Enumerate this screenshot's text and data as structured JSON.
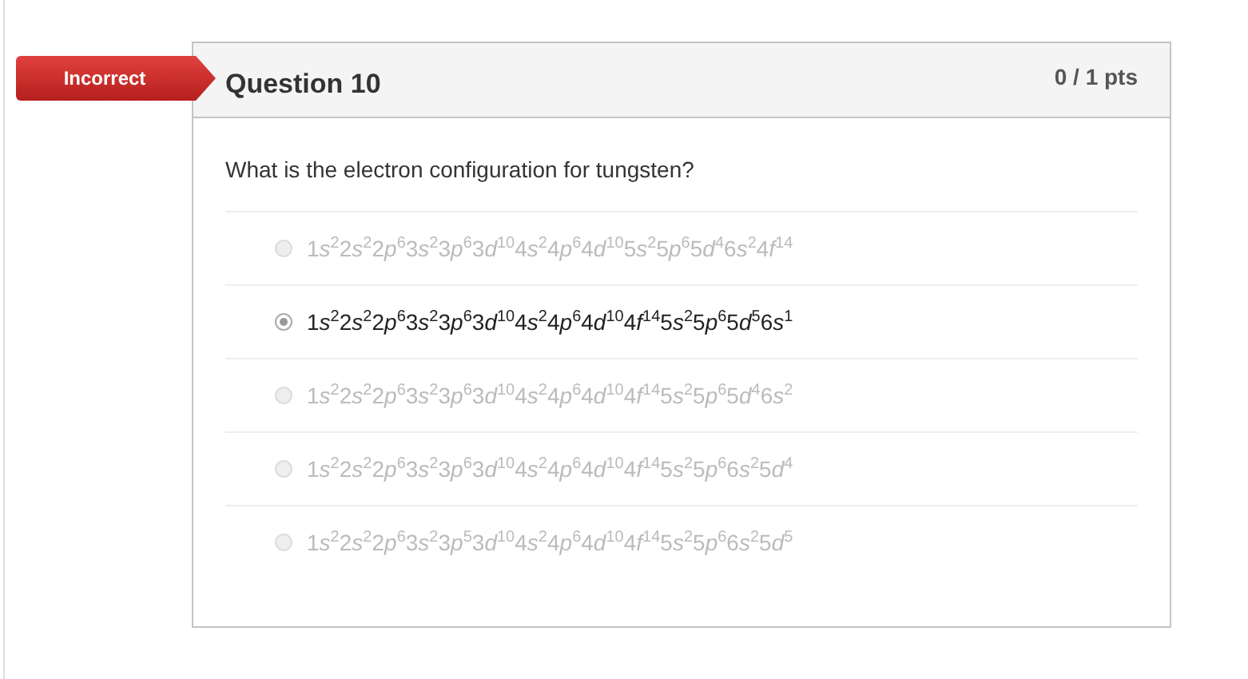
{
  "result_badge": "Incorrect",
  "question": {
    "title": "Question 10",
    "points": "0 / 1 pts",
    "text": "What is the electron configuration for tungsten?"
  },
  "answers": [
    {
      "selected": false,
      "terms": [
        [
          "1",
          "s",
          "2"
        ],
        [
          "2",
          "s",
          "2"
        ],
        [
          "2",
          "p",
          "6"
        ],
        [
          "3",
          "s",
          "2"
        ],
        [
          "3",
          "p",
          "6"
        ],
        [
          "3",
          "d",
          "10"
        ],
        [
          "4",
          "s",
          "2"
        ],
        [
          "4",
          "p",
          "6"
        ],
        [
          "4",
          "d",
          "10"
        ],
        [
          "5",
          "s",
          "2"
        ],
        [
          "5",
          "p",
          "6"
        ],
        [
          "5",
          "d",
          "4"
        ],
        [
          "6",
          "s",
          "2"
        ],
        [
          "4",
          "f",
          "14"
        ]
      ]
    },
    {
      "selected": true,
      "terms": [
        [
          "1",
          "s",
          "2"
        ],
        [
          "2",
          "s",
          "2"
        ],
        [
          "2",
          "p",
          "6"
        ],
        [
          "3",
          "s",
          "2"
        ],
        [
          "3",
          "p",
          "6"
        ],
        [
          "3",
          "d",
          "10"
        ],
        [
          "4",
          "s",
          "2"
        ],
        [
          "4",
          "p",
          "6"
        ],
        [
          "4",
          "d",
          "10"
        ],
        [
          "4",
          "f",
          "14"
        ],
        [
          "5",
          "s",
          "2"
        ],
        [
          "5",
          "p",
          "6"
        ],
        [
          "5",
          "d",
          "5"
        ],
        [
          "6",
          "s",
          "1"
        ]
      ]
    },
    {
      "selected": false,
      "terms": [
        [
          "1",
          "s",
          "2"
        ],
        [
          "2",
          "s",
          "2"
        ],
        [
          "2",
          "p",
          "6"
        ],
        [
          "3",
          "s",
          "2"
        ],
        [
          "3",
          "p",
          "6"
        ],
        [
          "3",
          "d",
          "10"
        ],
        [
          "4",
          "s",
          "2"
        ],
        [
          "4",
          "p",
          "6"
        ],
        [
          "4",
          "d",
          "10"
        ],
        [
          "4",
          "f",
          "14"
        ],
        [
          "5",
          "s",
          "2"
        ],
        [
          "5",
          "p",
          "6"
        ],
        [
          "5",
          "d",
          "4"
        ],
        [
          "6",
          "s",
          "2"
        ]
      ]
    },
    {
      "selected": false,
      "terms": [
        [
          "1",
          "s",
          "2"
        ],
        [
          "2",
          "s",
          "2"
        ],
        [
          "2",
          "p",
          "6"
        ],
        [
          "3",
          "s",
          "2"
        ],
        [
          "3",
          "p",
          "6"
        ],
        [
          "3",
          "d",
          "10"
        ],
        [
          "4",
          "s",
          "2"
        ],
        [
          "4",
          "p",
          "6"
        ],
        [
          "4",
          "d",
          "10"
        ],
        [
          "4",
          "f",
          "14"
        ],
        [
          "5",
          "s",
          "2"
        ],
        [
          "5",
          "p",
          "6"
        ],
        [
          "6",
          "s",
          "2"
        ],
        [
          "5",
          "d",
          "4"
        ]
      ]
    },
    {
      "selected": false,
      "terms": [
        [
          "1",
          "s",
          "2"
        ],
        [
          "2",
          "s",
          "2"
        ],
        [
          "2",
          "p",
          "6"
        ],
        [
          "3",
          "s",
          "2"
        ],
        [
          "3",
          "p",
          "5"
        ],
        [
          "3",
          "d",
          "10"
        ],
        [
          "4",
          "s",
          "2"
        ],
        [
          "4",
          "p",
          "6"
        ],
        [
          "4",
          "d",
          "10"
        ],
        [
          "4",
          "f",
          "14"
        ],
        [
          "5",
          "s",
          "2"
        ],
        [
          "5",
          "p",
          "6"
        ],
        [
          "6",
          "s",
          "2"
        ],
        [
          "5",
          "d",
          "5"
        ]
      ]
    }
  ]
}
